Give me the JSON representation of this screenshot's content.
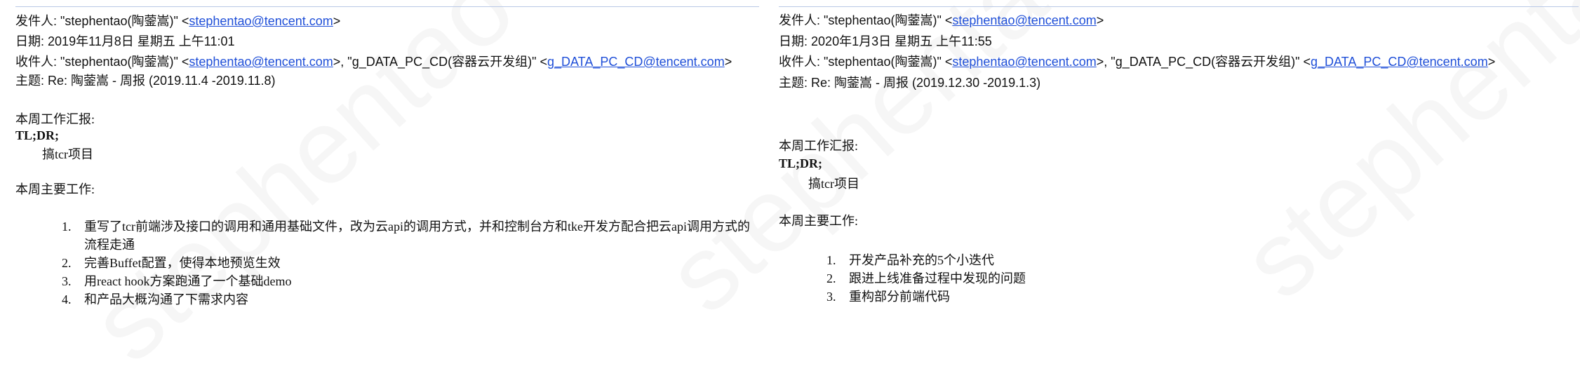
{
  "watermark_text": "stephentao",
  "emails": [
    {
      "from_label": "发件人:",
      "from_name": "\"stephentao(陶蓥嵩)\" <",
      "from_email": "stephentao@tencent.com",
      "from_close": ">",
      "date_label": "日期:",
      "date_value": "2019年11月8日 星期五 上午11:01",
      "to_label": "收件人:",
      "to_name1": "\"stephentao(陶蓥嵩)\" <",
      "to_email1": "stephentao@tencent.com",
      "to_sep": ">, \"g_DATA_PC_CD(容器云开发组)\" <",
      "to_email2": "g_DATA_PC_CD@tencent.com",
      "to_close": ">",
      "subject_label": "主题:",
      "subject_value": "Re: 陶蓥嵩 - 周报 (2019.11.4 -2019.11.8)",
      "report_heading": "本周工作汇报:",
      "tldr": "TL;DR;",
      "summary": "搞tcr项目",
      "main_work_heading": "本周主要工作:",
      "items": [
        {
          "num": "1.",
          "text": "重写了tcr前端涉及接口的调用和通用基础文件，改为云api的调用方式，并和控制台方和tke开发方配合把云api调用方式的流程走通"
        },
        {
          "num": "2.",
          "text": "完善Buffet配置，使得本地预览生效"
        },
        {
          "num": "3.",
          "text": "用react hook方案跑通了一个基础demo"
        },
        {
          "num": "4.",
          "text": "和产品大概沟通了下需求内容"
        }
      ]
    },
    {
      "from_label": "发件人:",
      "from_name": "\"stephentao(陶蓥嵩)\" <",
      "from_email": "stephentao@tencent.com",
      "from_close": ">",
      "date_label": "日期:",
      "date_value": "2020年1月3日 星期五 上午11:55",
      "to_label": "收件人:",
      "to_name1": "\"stephentao(陶蓥嵩)\" <",
      "to_email1": "stephentao@tencent.com",
      "to_sep": ">, \"g_DATA_PC_CD(容器云开发组)\" <",
      "to_email2": "g_DATA_PC_CD@tencent.com",
      "to_close": ">",
      "subject_label": "主题:",
      "subject_value": "Re: 陶蓥嵩 - 周报 (2019.12.30 -2019.1.3)",
      "report_heading": "本周工作汇报:",
      "tldr": "TL;DR;",
      "summary": "搞tcr项目",
      "main_work_heading": "本周主要工作:",
      "items": [
        {
          "num": "1.",
          "text": "开发产品补充的5个小迭代"
        },
        {
          "num": "2.",
          "text": "跟进上线准备过程中发现的问题"
        },
        {
          "num": "3.",
          "text": "重构部分前端代码"
        }
      ]
    }
  ]
}
